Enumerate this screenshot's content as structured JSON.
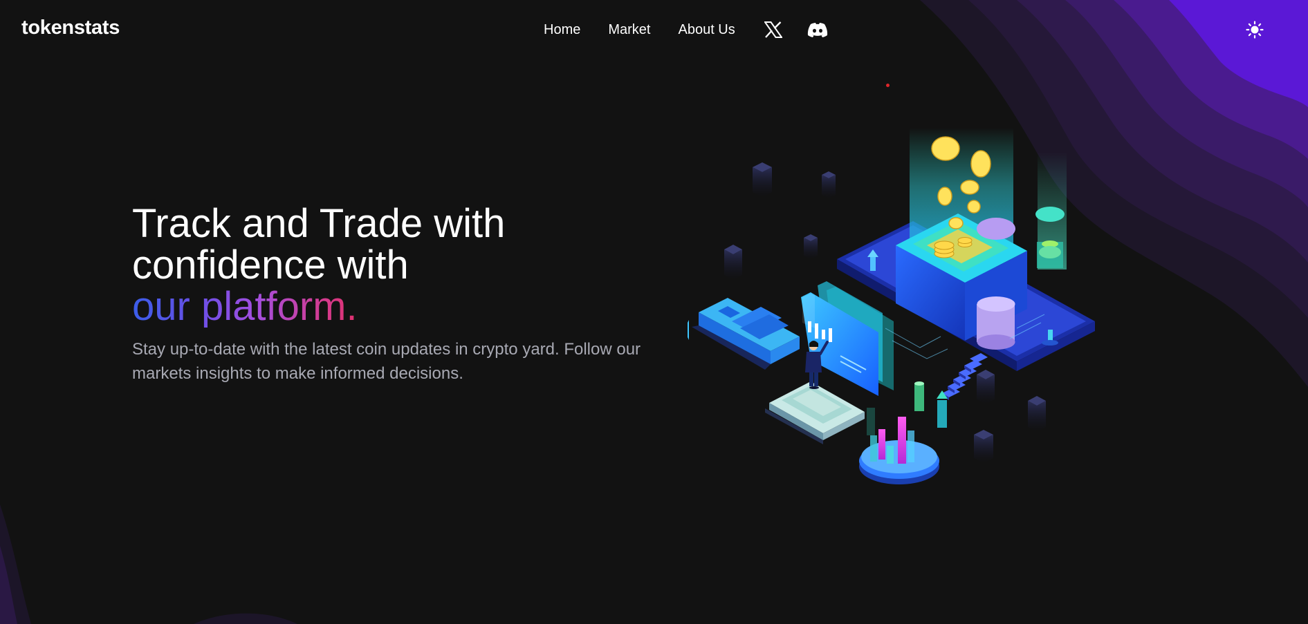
{
  "brand": {
    "name": "tokenstats"
  },
  "nav": {
    "items": [
      {
        "label": "Home"
      },
      {
        "label": "Market"
      },
      {
        "label": "About Us"
      }
    ],
    "social_icons": [
      "x-twitter-icon",
      "discord-icon"
    ]
  },
  "theme_toggle": {
    "icon": "sun-icon"
  },
  "hero": {
    "headline_line1": "Track and Trade with",
    "headline_line2": "confidence with",
    "headline_highlight": "our platform.",
    "subtext": "Stay up-to-date with the latest coin updates in crypto yard. Follow our markets insights to make informed decisions."
  },
  "colors": {
    "background": "#121212",
    "wave_accent": "#5b18d6",
    "gradient_start": "#3b5de8",
    "gradient_end": "#e0306e",
    "subtext": "#a8a9b3"
  },
  "illustration": {
    "icon": "crypto-isometric-illustration"
  }
}
